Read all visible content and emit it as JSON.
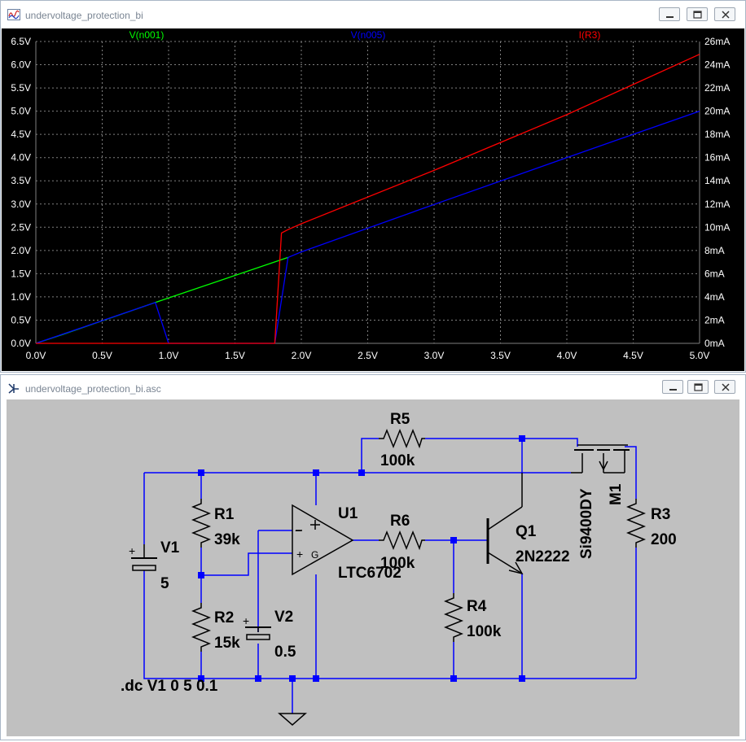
{
  "plot_window": {
    "title": "undervoltage_protection_bi",
    "buttons": [
      "minimize",
      "restore",
      "close"
    ]
  },
  "schematic_window": {
    "title": "undervoltage_protection_bi.asc",
    "buttons": [
      "minimize",
      "restore",
      "close"
    ]
  },
  "colors": {
    "plot_background": "#000000",
    "axis_text": "#ffffff",
    "trace_v_n001": "#00ff00",
    "trace_v_n005": "#0000ff",
    "trace_i_r3": "#ff0000",
    "schematic_background": "#c0c0c0",
    "wire": "#0000ff",
    "component": "#000000"
  },
  "chart_data": {
    "type": "line",
    "series": [
      {
        "name": "V(n001)",
        "axis": "left",
        "color": "#00ff00",
        "x": [
          0.0,
          0.2,
          0.9,
          1.9
        ],
        "y": [
          0.0,
          0.19,
          0.88,
          1.85
        ]
      },
      {
        "name": "V(n005)",
        "axis": "left",
        "color": "#0000ff",
        "x": [
          0.0,
          0.9,
          1.0,
          1.8,
          1.9,
          2.0,
          3.0,
          4.0,
          5.0
        ],
        "y": [
          0.0,
          0.88,
          0.0,
          0.0,
          1.85,
          1.97,
          2.99,
          4.0,
          5.0
        ]
      },
      {
        "name": "I(R3)",
        "axis": "right",
        "color": "#ff0000",
        "x": [
          0.0,
          1.8,
          1.85,
          1.9,
          2.0,
          3.0,
          4.0,
          5.0
        ],
        "y": [
          0.0,
          0.0,
          9.5,
          9.8,
          10.3,
          14.9,
          19.7,
          24.9
        ]
      }
    ],
    "xlim": [
      0.0,
      5.0
    ],
    "ylim_left": [
      0.0,
      6.5
    ],
    "ylim_right": [
      0.0,
      26.0
    ],
    "x_ticks": [
      "0.0V",
      "0.5V",
      "1.0V",
      "1.5V",
      "2.0V",
      "2.5V",
      "3.0V",
      "3.5V",
      "4.0V",
      "4.5V",
      "5.0V"
    ],
    "y_ticks_left": [
      "0.0V",
      "0.5V",
      "1.0V",
      "1.5V",
      "2.0V",
      "2.5V",
      "3.0V",
      "3.5V",
      "4.0V",
      "4.5V",
      "5.0V",
      "5.5V",
      "6.0V",
      "6.5V"
    ],
    "y_ticks_right": [
      "0mA",
      "2mA",
      "4mA",
      "6mA",
      "8mA",
      "10mA",
      "12mA",
      "14mA",
      "16mA",
      "18mA",
      "20mA",
      "22mA",
      "24mA",
      "26mA"
    ],
    "grid": true,
    "legend": "top"
  },
  "schematic": {
    "labels": {
      "r5_name": "R5",
      "r5_value": "100k",
      "r1_name": "R1",
      "r1_value": "39k",
      "r2_name": "R2",
      "r2_value": "15k",
      "v1_name": "V1",
      "v1_value": "5",
      "v2_name": "V2",
      "v2_value": "0.5",
      "u1_name": "U1",
      "u1_value": "LTC6702",
      "r6_name": "R6",
      "r6_value": "100k",
      "r4_name": "R4",
      "r4_value": "100k",
      "q1_name": "Q1",
      "q1_value": "2N2222",
      "m1_name": "M1",
      "m1_value": "Si9400DY",
      "r3_name": "R3",
      "r3_value": "200",
      "directive": ".dc V1 0 5 0.1",
      "plus1": "+",
      "plus2": "+",
      "opamp_minus": "−",
      "opamp_plus": "+",
      "opamp_g": "G"
    }
  }
}
